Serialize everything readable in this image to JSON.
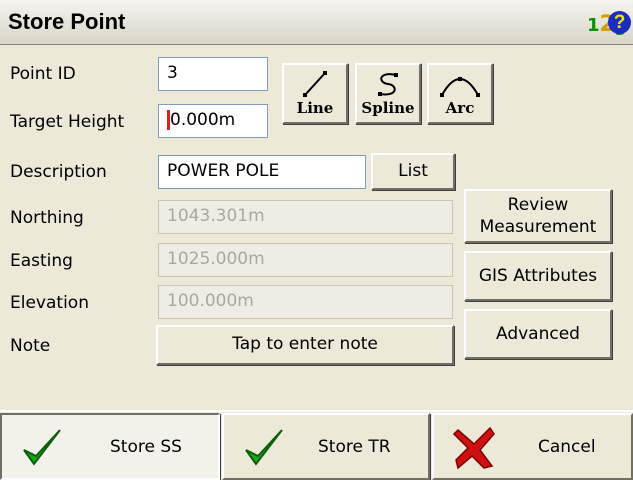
{
  "window": {
    "title": "Store Point"
  },
  "header_icons": {
    "keypad": "keypad-123-icon",
    "help": "help-icon",
    "help_glyph": "?"
  },
  "keypad_digits": {
    "d1": "1",
    "d2": "2",
    "d3": "3"
  },
  "form": {
    "point_id": {
      "label": "Point ID",
      "value": "3"
    },
    "target_height": {
      "label": "Target Height",
      "value": "0.000m"
    },
    "description": {
      "label": "Description",
      "value": "POWER POLE"
    },
    "northing": {
      "label": "Northing",
      "value": "1043.301m"
    },
    "easting": {
      "label": "Easting",
      "value": "1025.000m"
    },
    "elevation": {
      "label": "Elevation",
      "value": "100.000m"
    },
    "note": {
      "label": "Note",
      "button_label": "Tap to enter note"
    }
  },
  "geometry_buttons": {
    "line": "Line",
    "spline": "Spline",
    "arc": "Arc"
  },
  "list_button": "List",
  "side_buttons": {
    "review_line1": "Review",
    "review_line2": "Measurement",
    "gis": "GIS Attributes",
    "advanced": "Advanced"
  },
  "bottom_buttons": {
    "store_ss": "Store SS",
    "store_tr": "Store TR",
    "cancel": "Cancel"
  },
  "colors": {
    "check": "#1aa81a",
    "cancel_x": "#d01010",
    "help_bg": "#1b2dbf"
  }
}
